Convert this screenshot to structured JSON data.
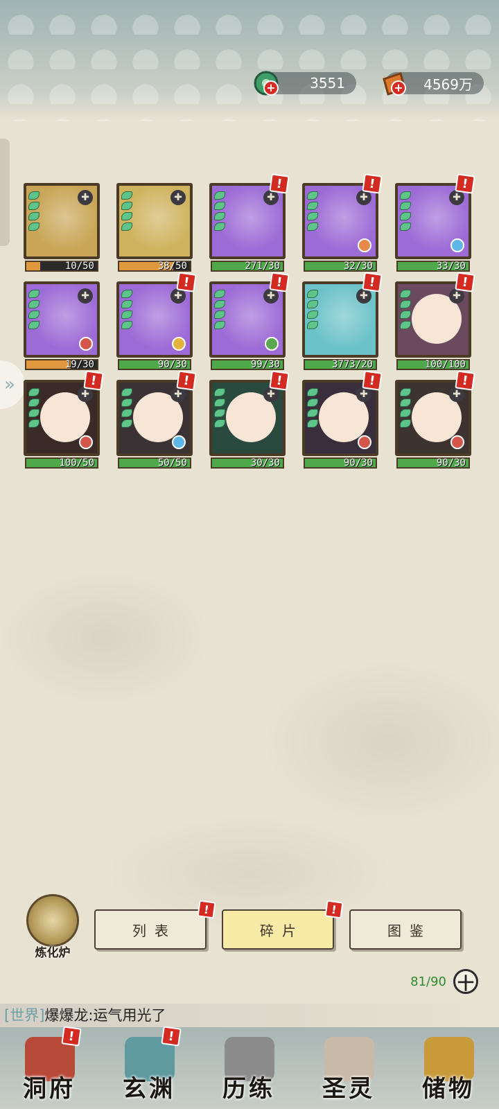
{
  "currency": {
    "jade": {
      "icon": "jade-coin-icon",
      "value": "3551",
      "plus": "+"
    },
    "gold": {
      "icon": "gold-ingot-icon",
      "value": "4569万",
      "plus": "+"
    }
  },
  "alert_mark": "!",
  "puzzle_glyph": "✚",
  "pets": [
    {
      "name": "tiger",
      "progress": "10/50",
      "ratio": 0.2,
      "fill": "orange",
      "alert": false,
      "bg": "#c9a657",
      "element": ""
    },
    {
      "name": "tiger-gold",
      "progress": "38/50",
      "ratio": 0.76,
      "fill": "orange",
      "alert": false,
      "bg": "#cfb35f",
      "element": ""
    },
    {
      "name": "purple-beast",
      "progress": "271/30",
      "ratio": 1,
      "fill": "green",
      "alert": true,
      "bg": "#9d6bd6",
      "element": ""
    },
    {
      "name": "purple-beast-fire",
      "progress": "32/30",
      "ratio": 1,
      "fill": "green",
      "alert": true,
      "bg": "#9d6bd6",
      "element": "#e68a4a"
    },
    {
      "name": "purple-beast-water",
      "progress": "33/30",
      "ratio": 1,
      "fill": "green",
      "alert": true,
      "bg": "#9d6bd6",
      "element": "#5fb7e8"
    },
    {
      "name": "purple-beast-red",
      "progress": "19/30",
      "ratio": 0.63,
      "fill": "orange",
      "alert": false,
      "bg": "#9d6bd6",
      "element": "#d4564a"
    },
    {
      "name": "purple-beast-gold",
      "progress": "90/30",
      "ratio": 1,
      "fill": "green",
      "alert": true,
      "bg": "#9d6bd6",
      "element": "#e2b43d"
    },
    {
      "name": "purple-beast-wood",
      "progress": "99/30",
      "ratio": 1,
      "fill": "green",
      "alert": true,
      "bg": "#9d6bd6",
      "element": "#5aa84f"
    },
    {
      "name": "teal-beast",
      "progress": "3773/20",
      "ratio": 1,
      "fill": "green",
      "alert": true,
      "bg": "#6cc2c9",
      "element": ""
    },
    {
      "name": "dumpling-spirit",
      "progress": "100/100",
      "ratio": 1,
      "fill": "green",
      "alert": true,
      "bg": "#6b4a60",
      "element": ""
    },
    {
      "name": "red-hair-girl",
      "progress": "100/50",
      "ratio": 1,
      "fill": "green",
      "alert": true,
      "bg": "#3a2a28",
      "element": "#d4564a"
    },
    {
      "name": "silver-hair-boy",
      "progress": "50/50",
      "ratio": 1,
      "fill": "green",
      "alert": true,
      "bg": "#3a3234",
      "element": "#5fb7e8"
    },
    {
      "name": "green-beast",
      "progress": "30/30",
      "ratio": 1,
      "fill": "green",
      "alert": true,
      "bg": "#2b4a3f",
      "element": ""
    },
    {
      "name": "dark-hair-boy",
      "progress": "90/30",
      "ratio": 1,
      "fill": "green",
      "alert": true,
      "bg": "#3a2e3c",
      "element": "#d4564a"
    },
    {
      "name": "white-hair-warrior",
      "progress": "90/30",
      "ratio": 1,
      "fill": "green",
      "alert": true,
      "bg": "#3d3330",
      "element": "#d4564a"
    }
  ],
  "furnace": {
    "label": "炼化炉"
  },
  "tabs": [
    {
      "label": "列表",
      "active": false,
      "alert": true
    },
    {
      "label": "碎片",
      "active": true,
      "alert": true
    },
    {
      "label": "图鉴",
      "active": false,
      "alert": false
    }
  ],
  "capacity": "81/90",
  "expand_label": "十",
  "chat": {
    "channel": "[世界]",
    "message": "爆爆龙:运气用光了"
  },
  "nav": [
    {
      "label": "洞府",
      "alert": true,
      "color": "#b84a3a"
    },
    {
      "label": "玄渊",
      "alert": true,
      "color": "#5f9aa0"
    },
    {
      "label": "历练",
      "alert": false,
      "color": "#8c8c8c"
    },
    {
      "label": "圣灵",
      "alert": false,
      "color": "#c9b9a8"
    },
    {
      "label": "储物",
      "alert": false,
      "color": "#c99a3a"
    }
  ]
}
